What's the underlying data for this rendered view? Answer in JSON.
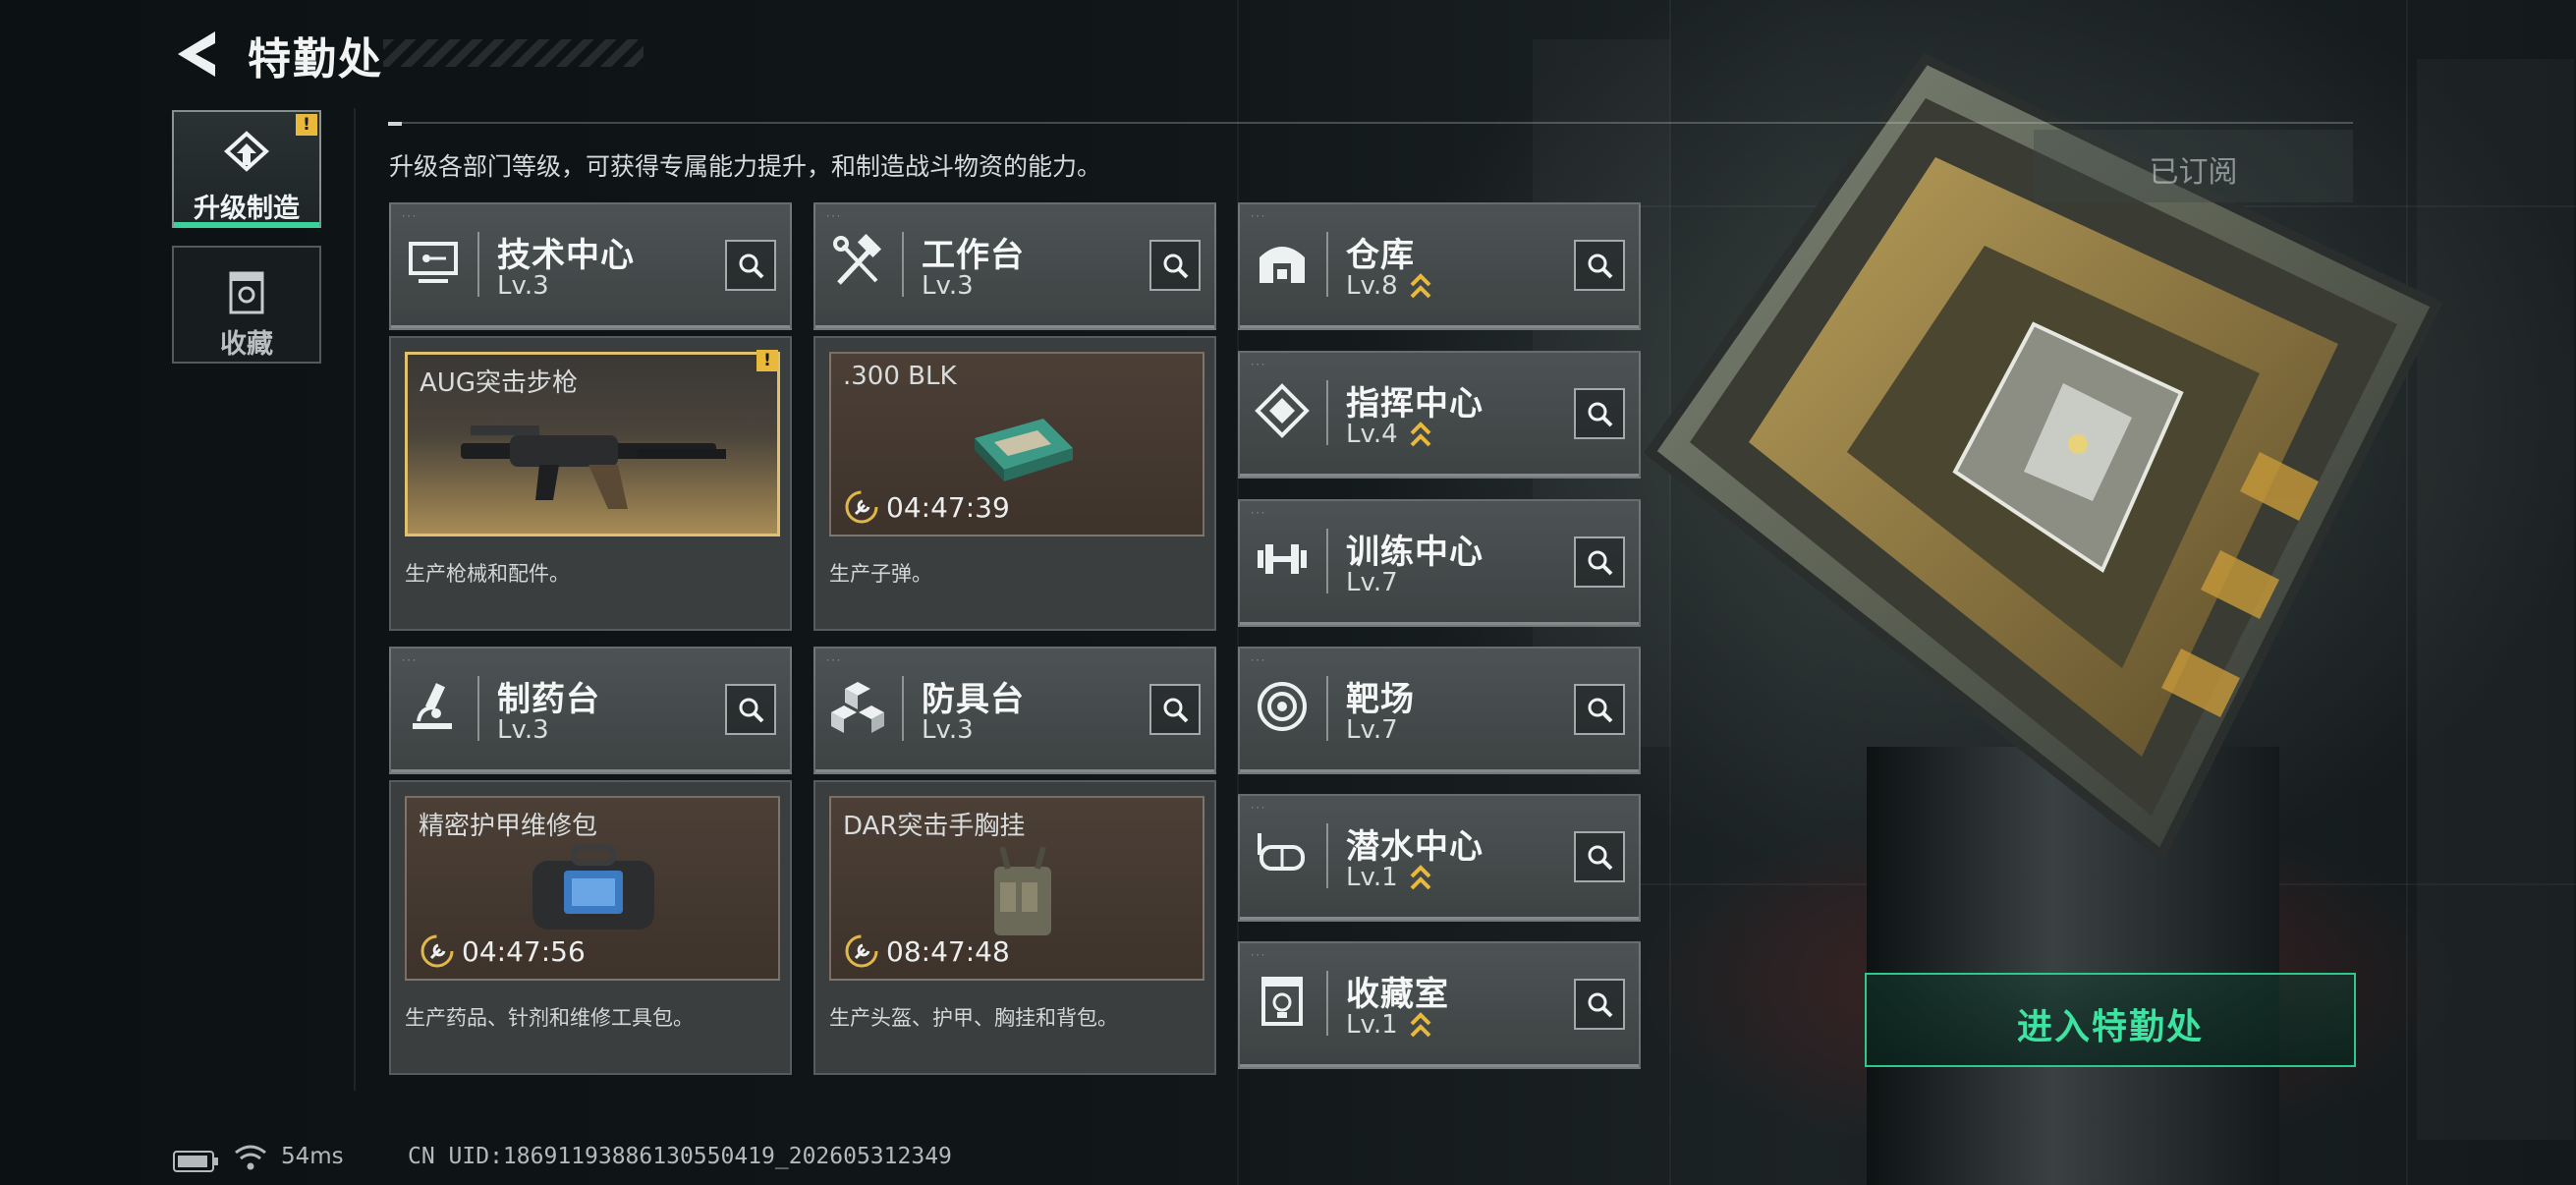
{
  "header": {
    "title": "特勤处"
  },
  "subtitle": "升级各部门等级，可获得专属能力提升，和制造战斗物资的能力。",
  "side_tabs": [
    {
      "label": "升级制造",
      "active": true,
      "alert": "!"
    },
    {
      "label": "收藏",
      "active": false
    }
  ],
  "departments": {
    "tech": {
      "name": "技术中心",
      "level": "Lv.3",
      "upgradable": false
    },
    "workbench": {
      "name": "工作台",
      "level": "Lv.3",
      "upgradable": false
    },
    "warehouse": {
      "name": "仓库",
      "level": "Lv.8",
      "upgradable": true
    },
    "command": {
      "name": "指挥中心",
      "level": "Lv.4",
      "upgradable": true
    },
    "training": {
      "name": "训练中心",
      "level": "Lv.7",
      "upgradable": false
    },
    "pharma": {
      "name": "制药台",
      "level": "Lv.3",
      "upgradable": false
    },
    "armor": {
      "name": "防具台",
      "level": "Lv.3",
      "upgradable": false
    },
    "range": {
      "name": "靶场",
      "level": "Lv.7",
      "upgradable": false
    },
    "diving": {
      "name": "潜水中心",
      "level": "Lv.1",
      "upgradable": true
    },
    "collection": {
      "name": "收藏室",
      "level": "Lv.1",
      "upgradable": true
    }
  },
  "production": {
    "tech": {
      "item": "AUG突击步枪",
      "status": "ready",
      "alert": "!",
      "desc": "生产枪械和配件。"
    },
    "workbench": {
      "item": ".300 BLK",
      "timer": "04:47:39",
      "desc": "生产子弹。"
    },
    "pharma": {
      "item": "精密护甲维修包",
      "timer": "04:47:56",
      "desc": "生产药品、针剂和维修工具包。"
    },
    "armor": {
      "item": "DAR突击手胸挂",
      "timer": "08:47:48",
      "desc": "生产头盔、护甲、胸挂和背包。"
    }
  },
  "right_panel": {
    "subscribed_label": "已订阅",
    "enter_label": "进入特勤处"
  },
  "status_bar": {
    "ping": "54ms",
    "uid": "CN UID:18691193886130550419_202605312349"
  },
  "colors": {
    "accent_green": "#3ad29a",
    "upgrade_gold": "#e8b93b",
    "ready_border": "#e2c06e"
  }
}
